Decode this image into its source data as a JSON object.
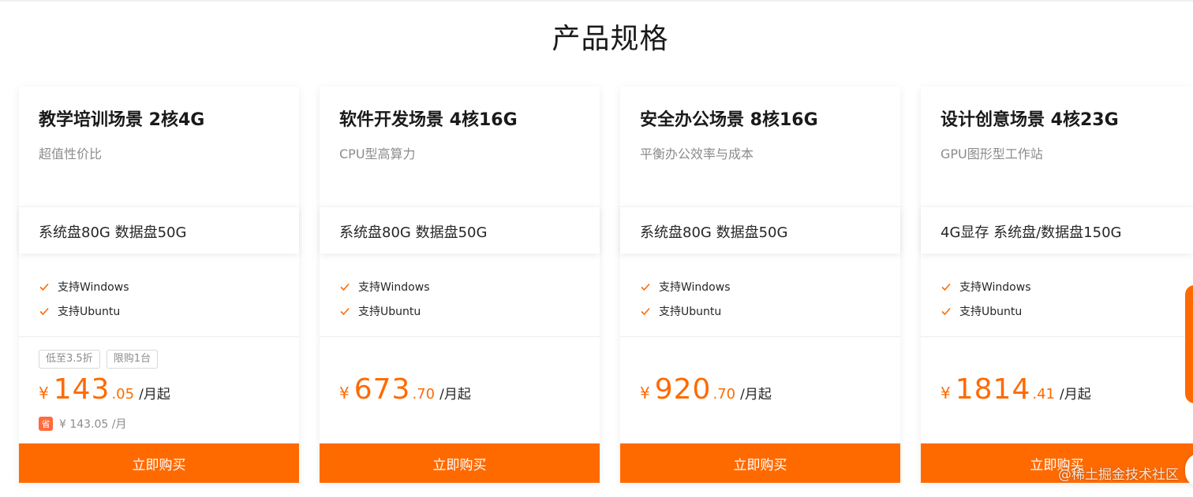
{
  "section": {
    "title": "产品规格"
  },
  "colors": {
    "accent": "#ff6a00",
    "save_badge": "#ff6a3d"
  },
  "cards": [
    {
      "title": "教学培训场景 2核4G",
      "subtitle": "超值性价比",
      "spec": "系统盘80G 数据盘50G",
      "features": [
        "支持Windows",
        "支持Ubuntu"
      ],
      "tags": [
        "低至3.5折",
        "限购1台"
      ],
      "price": {
        "currency": "¥",
        "integer": "143",
        "decimal": ".05",
        "unit": "/月起"
      },
      "original_price": "¥ 143.05 /月",
      "save_badge": "省",
      "button": "立即购买"
    },
    {
      "title": "软件开发场景 4核16G",
      "subtitle": "CPU型高算力",
      "spec": "系统盘80G 数据盘50G",
      "features": [
        "支持Windows",
        "支持Ubuntu"
      ],
      "price": {
        "currency": "¥",
        "integer": "673",
        "decimal": ".70",
        "unit": "/月起"
      },
      "button": "立即购买"
    },
    {
      "title": "安全办公场景 8核16G",
      "subtitle": "平衡办公效率与成本",
      "spec": "系统盘80G 数据盘50G",
      "features": [
        "支持Windows",
        "支持Ubuntu"
      ],
      "price": {
        "currency": "¥",
        "integer": "920",
        "decimal": ".70",
        "unit": "/月起"
      },
      "button": "立即购买"
    },
    {
      "title": "设计创意场景 4核23G",
      "subtitle": "GPU图形型工作站",
      "spec": "4G显存 系统盘/数据盘150G",
      "features": [
        "支持Windows",
        "支持Ubuntu"
      ],
      "price": {
        "currency": "¥",
        "integer": "1814",
        "decimal": ".41",
        "unit": "/月起"
      },
      "button": "立即购买"
    }
  ],
  "watermark": "@稀土掘金技术社区"
}
